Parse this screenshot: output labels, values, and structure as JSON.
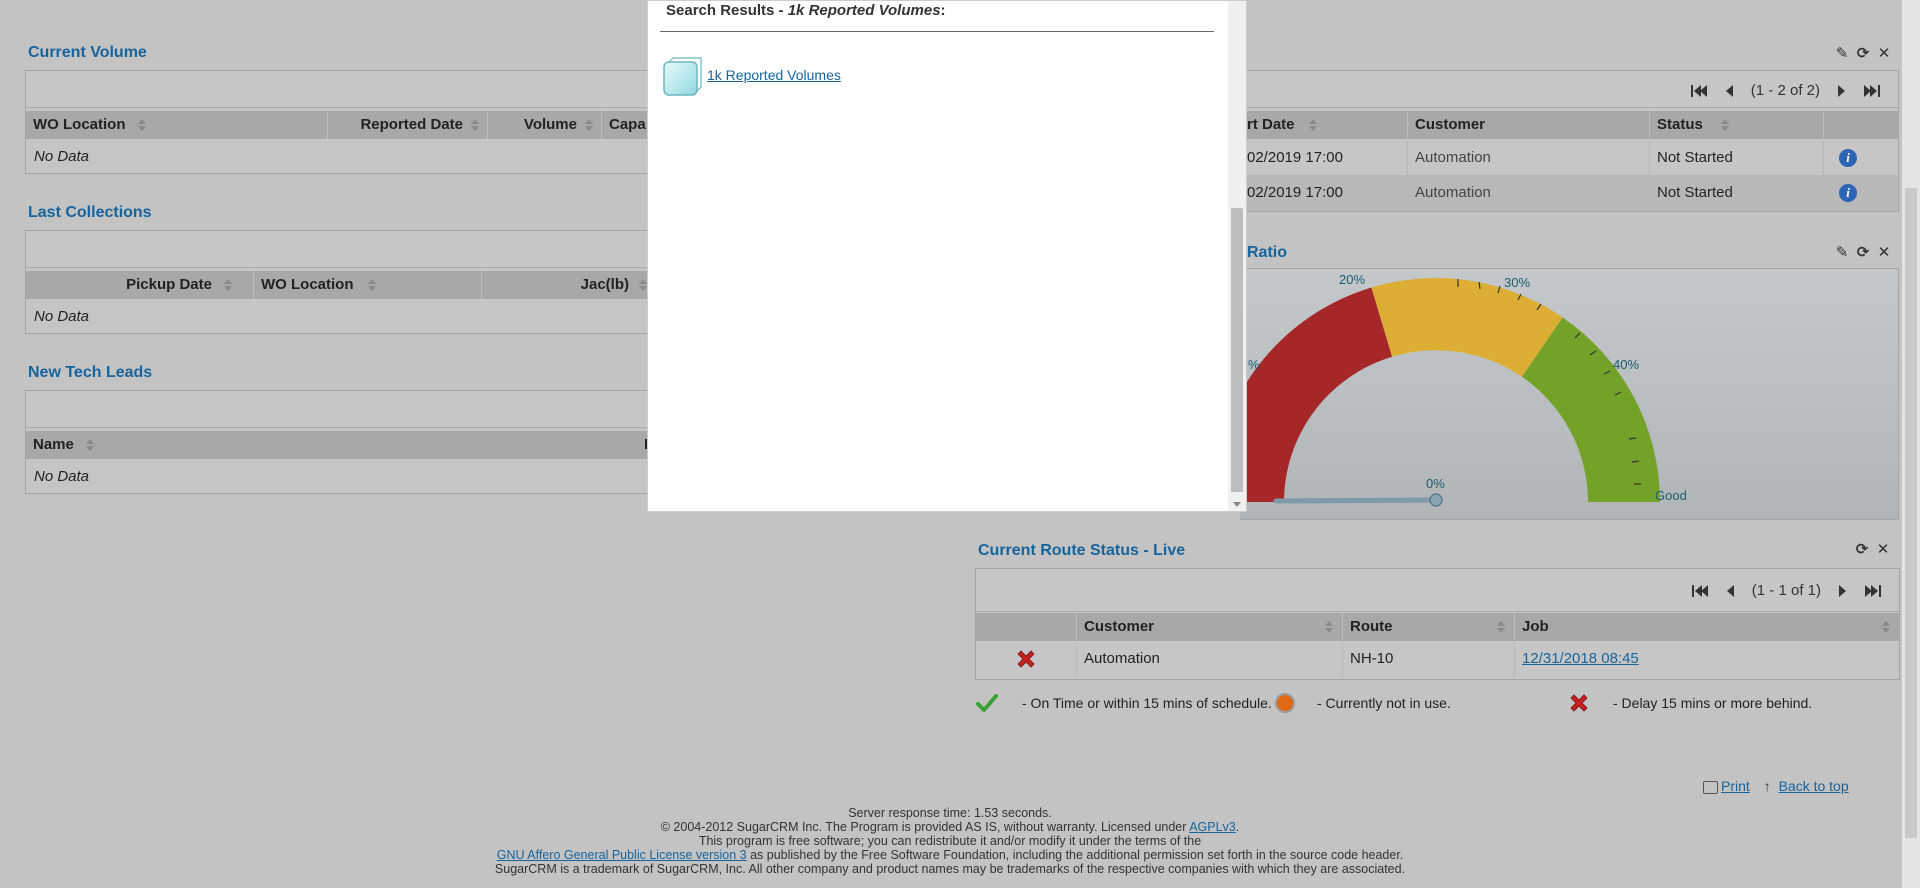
{
  "current_volume": {
    "title": "Current Volume",
    "columns": [
      "WO Location",
      "Reported Date",
      "Volume",
      "Capa"
    ],
    "no_data": "No Data"
  },
  "last_collections": {
    "title": "Last Collections",
    "columns": [
      "Pickup Date",
      "WO Location",
      "Jac(lb)"
    ],
    "no_data": "No Data"
  },
  "new_tech_leads": {
    "title": "New Tech Leads",
    "columns": [
      "Name",
      "F"
    ],
    "no_data": "No Data"
  },
  "top_right_dashlet": {
    "pager_text": "(1 - 2 of 2)",
    "columns": [
      "rt Date",
      "Customer",
      "Status"
    ],
    "rows": [
      {
        "date": "02/2019 17:00",
        "customer": "Automation",
        "status": "Not Started"
      },
      {
        "date": "02/2019 17:00",
        "customer": "Automation",
        "status": "Not Started"
      }
    ]
  },
  "gauge_dashlet": {
    "title_fragment": "Ratio",
    "labels": [
      "20%",
      "30%",
      "40%",
      "%",
      "0%",
      "Good"
    ],
    "value": 0
  },
  "route_status": {
    "title": "Current Route Status - Live",
    "pager_text": "(1 - 1 of 1)",
    "columns": [
      "Customer",
      "Route",
      "Job"
    ],
    "rows": [
      {
        "customer": "Automation",
        "route": "NH-10",
        "job": "12/31/2018 08:45"
      }
    ],
    "legend": {
      "on_time": "- On Time or within 15 mins of schedule.",
      "not_in_use": "- Currently not in use.",
      "delay": "- Delay 15 mins or more behind."
    }
  },
  "modal": {
    "heading_prefix": "Search Results - ",
    "heading_em": "1k Reported Volumes",
    "heading_suffix": ":",
    "result_link": "1k Reported Volumes"
  },
  "bottom_links": {
    "print": "Print",
    "back_to_top": "Back to top"
  },
  "footer": {
    "response_time": "Server response time: 1.53 seconds.",
    "copyright": "© 2004-2012 SugarCRM Inc. The Program is provided AS IS, without warranty. Licensed under ",
    "agpl_link": "AGPLv3",
    "line3": "This program is free software; you can redistribute it and/or modify it under the terms of the",
    "gnu_link": "GNU Affero General Public License version 3",
    "line4_rest": " as published by the Free Software Foundation, including the additional permission set forth in the source code header.",
    "trademark": "SugarCRM is a trademark of SugarCRM, Inc. All other company and product names may be trademarks of the respective companies with which they are associated."
  },
  "colors": {
    "title_blue": "#17649c",
    "gauge_red": "#b22a2a",
    "gauge_yellow": "#e0b52e",
    "gauge_green": "#7aa52a"
  }
}
